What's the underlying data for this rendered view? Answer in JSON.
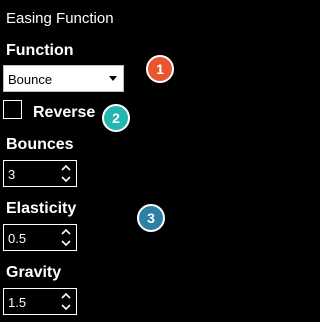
{
  "panel": {
    "title": "Easing Function"
  },
  "function": {
    "label": "Function",
    "selected": "Bounce"
  },
  "reverse": {
    "label": "Reverse",
    "checked": false
  },
  "bounces": {
    "label": "Bounces",
    "value": "3"
  },
  "elasticity": {
    "label": "Elasticity",
    "value": "0.5"
  },
  "gravity": {
    "label": "Gravity",
    "value": "1.5"
  },
  "callouts": [
    {
      "number": "1",
      "color": "#e8552f"
    },
    {
      "number": "2",
      "color": "#25b6b0"
    },
    {
      "number": "3",
      "color": "#2e7fa6"
    }
  ]
}
